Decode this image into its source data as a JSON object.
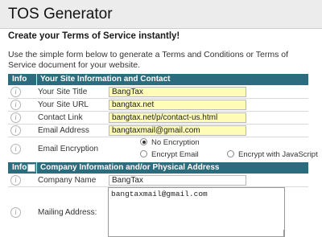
{
  "header": {
    "title": "TOS Generator"
  },
  "subtitle": "Create your Terms of Service instantly!",
  "intro": "Use the simple form below to generate a Terms and Conditions or Terms of Service document for your website.",
  "section1": {
    "info_label": "Info",
    "title": "Your Site Information and Contact",
    "rows": [
      {
        "label": "Your Site Title",
        "value": "BangTax"
      },
      {
        "label": "Your Site URL",
        "value": "bangtax.net"
      },
      {
        "label": "Contact Link",
        "value": "bangtax.net/p/contact-us.html"
      },
      {
        "label": "Email Address",
        "value": "bangtaxmail@gmail.com"
      }
    ],
    "encryption": {
      "label": "Email Encryption",
      "options": [
        "No Encryption",
        "Encrypt Email",
        "Encrypt with JavaScript"
      ],
      "selected": "No Encryption"
    }
  },
  "section2": {
    "info_label": "Info",
    "title": "Company Information and/or Physical Address",
    "company_label": "Company Name",
    "company_value": "BangTax",
    "mailing_label": "Mailing Address:",
    "mailing_value": "bangtaxmail@gmail.com"
  },
  "icons": {
    "info": "info-icon"
  },
  "colors": {
    "section_header": "#2b6d7e",
    "field_highlight": "#fffcb8"
  }
}
